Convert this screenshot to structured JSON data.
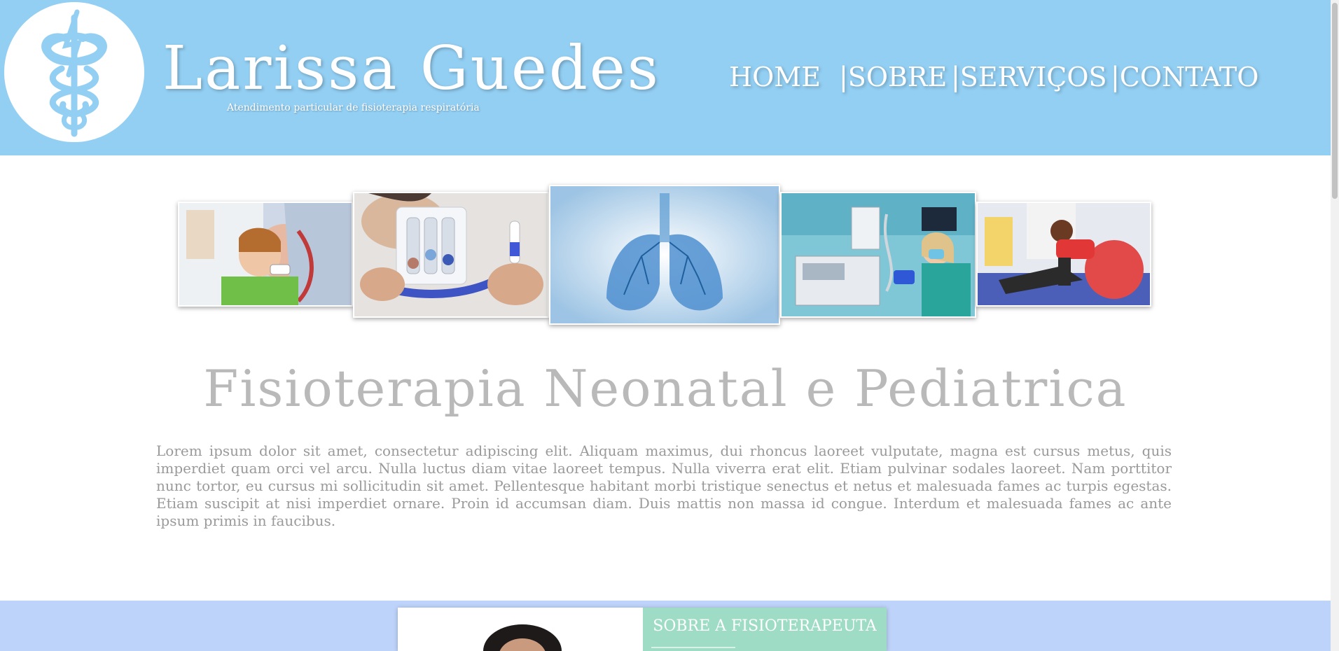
{
  "site": {
    "name": "Larissa Guedes",
    "tagline": "Atendimento particular de fisioterapia respiratória"
  },
  "logo": {
    "icon": "caduceus-icon"
  },
  "nav": [
    {
      "label": "HOME"
    },
    {
      "label": "|SOBRE"
    },
    {
      "label": "|SERVIÇOS"
    },
    {
      "label": "|CONTATO"
    }
  ],
  "gallery": [
    {
      "subject": "child using respiratory device with doctor"
    },
    {
      "subject": "patient using incentive spirometer"
    },
    {
      "subject": "illustrated lungs"
    },
    {
      "subject": "nurse at ventilator in hospital room"
    },
    {
      "subject": "child doing exercise ball therapy"
    }
  ],
  "main": {
    "title": "Fisioterapia Neonatal e Pediatrica",
    "text": "Lorem ipsum dolor sit amet, consectetur adipiscing elit. Aliquam maximus, dui rhoncus laoreet vulputate, magna est cursus metus, quis imperdiet quam orci vel arcu. Nulla luctus diam vitae laoreet tempus. Nulla viverra erat elit. Etiam pulvinar sodales laoreet. Nam porttitor nunc tortor, eu cursus mi sollicitudin sit amet. Pellentesque habitant morbi tristique senectus et netus et malesuada fames ac turpis egestas. Etiam suscipit at nisi imperdiet ornare. Proin id accumsan diam. Duis mattis non massa id congue. Interdum et malesuada fames ac ante ipsum primis in faucibus."
  },
  "about": {
    "title": "SOBRE A FISIOTERAPEUTA"
  },
  "colors": {
    "header_bg": "#93cff3",
    "about_band": "#bed3fa",
    "about_panel": "#9edcc5",
    "title_text": "#b9b9b9",
    "body_text": "#9a9a9a"
  }
}
